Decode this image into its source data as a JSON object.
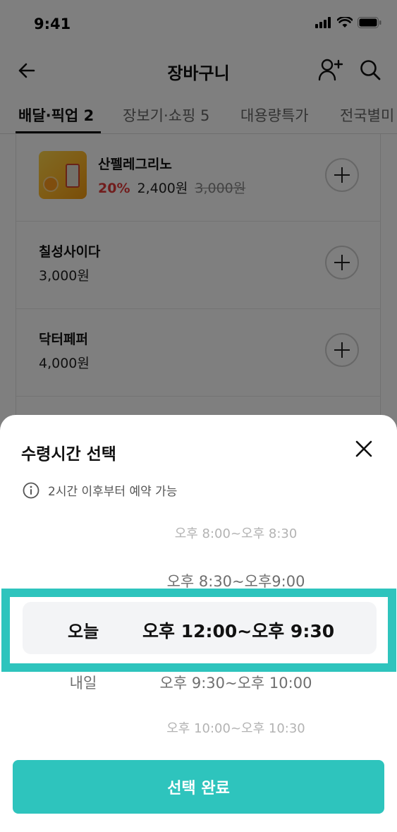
{
  "status_bar": {
    "time": "9:41"
  },
  "nav": {
    "title": "장바구니"
  },
  "tabs": [
    {
      "label": "배달·픽업 2",
      "active": true
    },
    {
      "label": "장보기·쇼핑 5",
      "active": false
    },
    {
      "label": "대용량특가",
      "active": false
    },
    {
      "label": "전국별미",
      "active": false
    }
  ],
  "items": [
    {
      "name": "산펠레그리노",
      "discount": "20%",
      "price": "2,400원",
      "original_price": "3,000원"
    },
    {
      "name": "칠성사이다",
      "price": "3,000원"
    },
    {
      "name": "닥터페퍼",
      "price": "4,000원"
    }
  ],
  "sheet": {
    "title": "수령시간 선택",
    "notice": "2시간 이후부터 예약 가능",
    "options": [
      {
        "day": "",
        "time": "오후 8:00~오후 8:30"
      },
      {
        "day": "",
        "time": "오후 8:30~오후9:00"
      },
      {
        "day": "오늘",
        "time": "오후 12:00~오후 9:30",
        "selected": true
      },
      {
        "day": "내일",
        "time": "오후 9:30~오후 10:00"
      },
      {
        "day": "",
        "time": "오후 10:00~오후 10:30"
      }
    ],
    "confirm_label": "선택 완료"
  },
  "colors": {
    "accent": "#2ec4bd",
    "discount": "#e23a3a",
    "selected_bg": "#f3f4f6"
  }
}
